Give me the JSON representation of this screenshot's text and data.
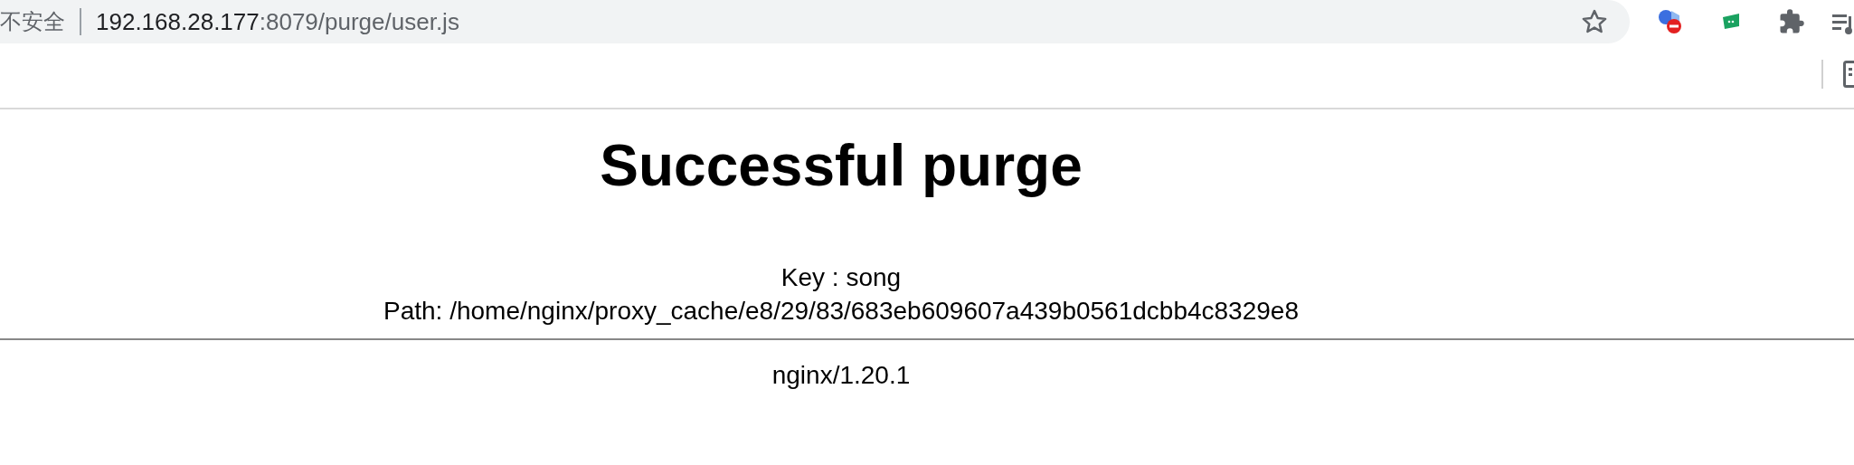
{
  "address_bar": {
    "security_label": "不安全",
    "host": "192.168.28.177",
    "rest": ":8079/purge/user.js"
  },
  "page": {
    "title": "Successful purge",
    "lines": [
      "Key : song",
      "Path: /home/nginx/proxy_cache/e8/29/83/683eb609607a439b0561dcbb4c8329e8"
    ],
    "footer": "nginx/1.20.1"
  }
}
